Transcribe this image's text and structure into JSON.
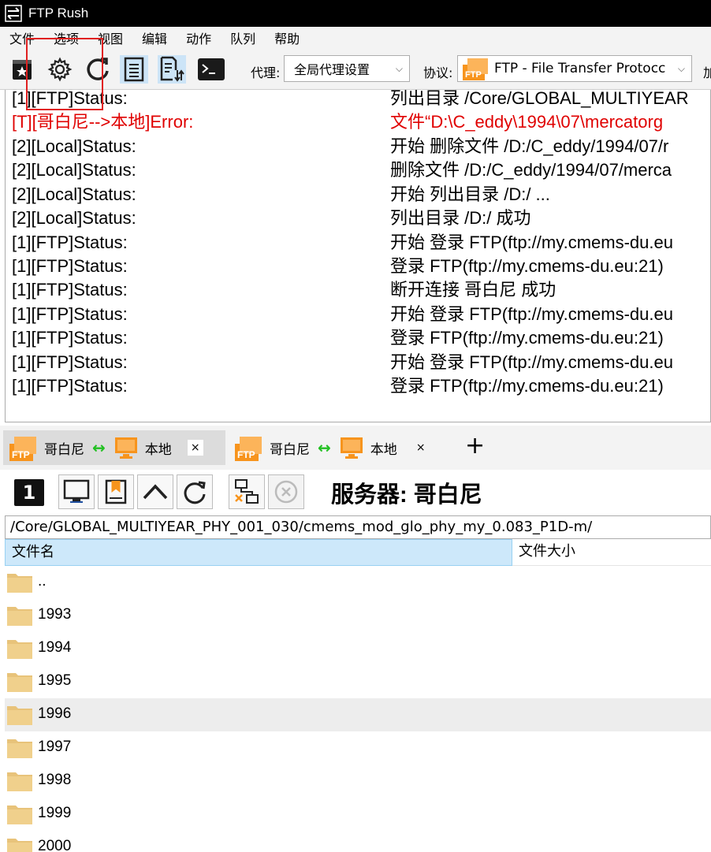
{
  "window": {
    "title": "FTP Rush"
  },
  "menu": [
    "文件",
    "选项",
    "视图",
    "编辑",
    "动作",
    "队列",
    "帮助"
  ],
  "toolbar": {
    "proxy_label": "代理:",
    "proxy_value": "全局代理设置",
    "protocol_label": "协议:",
    "protocol_value": "FTP - File Transfer Protocc",
    "overflow_label": "加"
  },
  "log": [
    {
      "src": "[1][FTP]Status:",
      "msg": "列出目录 /Core/GLOBAL_MULTIYEAR",
      "error": false
    },
    {
      "src": "[T][哥白尼-->本地]Error:",
      "msg": "文件“D:\\C_eddy\\1994\\07\\mercatorg",
      "error": true
    },
    {
      "src": "[2][Local]Status:",
      "msg": "开始 删除文件 /D:/C_eddy/1994/07/r",
      "error": false
    },
    {
      "src": "[2][Local]Status:",
      "msg": "删除文件 /D:/C_eddy/1994/07/merca",
      "error": false
    },
    {
      "src": "[2][Local]Status:",
      "msg": "开始 列出目录 /D:/ ...",
      "error": false
    },
    {
      "src": "[2][Local]Status:",
      "msg": "列出目录 /D:/ 成功",
      "error": false
    },
    {
      "src": "[1][FTP]Status:",
      "msg": "开始 登录 FTP(ftp://my.cmems-du.eu",
      "error": false
    },
    {
      "src": "[1][FTP]Status:",
      "msg": "登录 FTP(ftp://my.cmems-du.eu:21)",
      "error": false
    },
    {
      "src": "[1][FTP]Status:",
      "msg": "断开连接 哥白尼 成功",
      "error": false
    },
    {
      "src": "[1][FTP]Status:",
      "msg": "开始 登录 FTP(ftp://my.cmems-du.eu",
      "error": false
    },
    {
      "src": "[1][FTP]Status:",
      "msg": "登录 FTP(ftp://my.cmems-du.eu:21)",
      "error": false
    },
    {
      "src": "[1][FTP]Status:",
      "msg": "开始 登录 FTP(ftp://my.cmems-du.eu",
      "error": false
    },
    {
      "src": "[1][FTP]Status:",
      "msg": "登录 FTP(ftp://my.cmems-du.eu:21)",
      "error": false
    }
  ],
  "tabs": [
    {
      "remote": "哥白尼",
      "local": "本地",
      "close": "×"
    },
    {
      "remote": "哥白尼",
      "local": "本地",
      "close": "×"
    }
  ],
  "tab_add": "+",
  "panel": {
    "number": "1",
    "server_title": "服务器: 哥白尼",
    "path": "/Core/GLOBAL_MULTIYEAR_PHY_001_030/cmems_mod_glo_phy_my_0.083_P1D-m/",
    "col_name": "文件名",
    "col_size": "文件大小"
  },
  "files": [
    "..",
    "1993",
    "1994",
    "1995",
    "1996",
    "1997",
    "1998",
    "1999",
    "2000"
  ],
  "colors": {
    "error": "#e00000",
    "ftp_orange": "#f7941d",
    "selection": "#cde8fa",
    "highlight": "#e02020"
  },
  "icons": [
    "app-logo-icon",
    "bookmark-star-icon",
    "gear-icon",
    "refresh-icon",
    "log-list-icon",
    "transfer-list-icon",
    "terminal-icon",
    "ftp-badge-icon",
    "sync-arrows-icon",
    "monitor-icon",
    "computer-icon",
    "bookmark-icon",
    "up-arrow-icon",
    "reload-icon",
    "disconnect-icon",
    "cancel-icon",
    "folder-icon"
  ]
}
